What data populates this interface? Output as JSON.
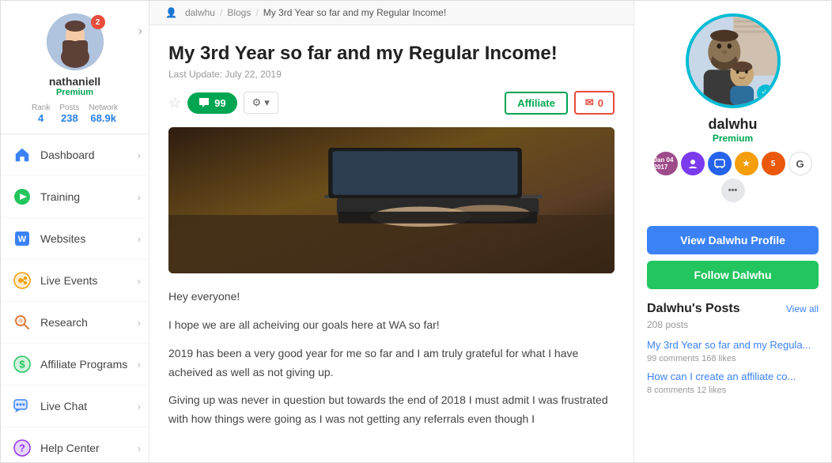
{
  "sidebar": {
    "profile": {
      "username": "nathaniell",
      "badge": "Premium",
      "notifications": "2",
      "rank_label": "Rank",
      "rank_value": "4",
      "posts_label": "Posts",
      "posts_value": "238",
      "network_label": "Network",
      "network_value": "68.9k"
    },
    "nav": [
      {
        "id": "dashboard",
        "label": "Dashboard",
        "icon": "home"
      },
      {
        "id": "training",
        "label": "Training",
        "icon": "play"
      },
      {
        "id": "websites",
        "label": "Websites",
        "icon": "globe"
      },
      {
        "id": "live-events",
        "label": "Live Events",
        "icon": "video"
      },
      {
        "id": "research",
        "label": "Research",
        "icon": "search"
      },
      {
        "id": "affiliate-programs",
        "label": "Affiliate Programs",
        "icon": "dollar"
      },
      {
        "id": "live-chat",
        "label": "Live Chat",
        "icon": "chat"
      },
      {
        "id": "help-center",
        "label": "Help Center",
        "icon": "question"
      }
    ]
  },
  "breadcrumb": {
    "user_icon": "👤",
    "user": "dalwhu",
    "blogs": "Blogs",
    "current": "My 3rd Year so far and my Regular Income!"
  },
  "post": {
    "title": "My 3rd Year so far and my Regular Income!",
    "date": "Last Update: July 22, 2019",
    "comment_count": "99",
    "settings_label": "⚙",
    "affiliate_label": "Affiliate",
    "mail_icon": "✉",
    "mail_count": "0",
    "body_p1": "Hey everyone!",
    "body_p2": "I hope we are all acheiving our goals here at WA so far!",
    "body_p3": "2019 has been a very good year for me so far and I am truly grateful for what I have acheived as well as not giving up.",
    "body_p4": "Giving up was never in question but towards the end of 2018 I must admit I was frustrated with how things were going as I was not getting any referrals even though I"
  },
  "right_profile": {
    "name": "dalwhu",
    "badge": "Premium",
    "view_profile_btn": "View Dalwhu Profile",
    "follow_btn": "Follow Dalwhu",
    "posts_section_title": "Dalwhu's Posts",
    "view_all": "View all",
    "posts_count": "208 posts",
    "posts": [
      {
        "title": "My 3rd Year so far and my Regula...",
        "meta": "99 comments  168 likes"
      },
      {
        "title": "How can I create an affiliate co...",
        "meta": "8 comments  12 likes"
      }
    ]
  }
}
